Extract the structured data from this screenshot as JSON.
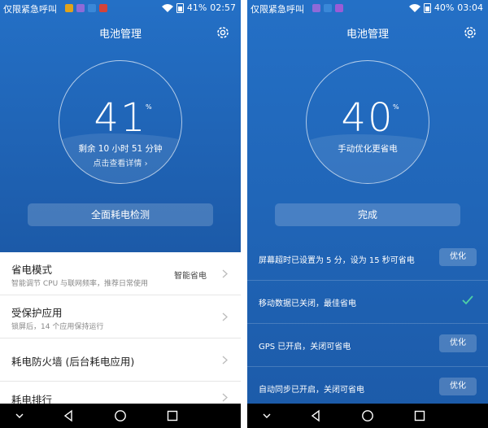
{
  "left": {
    "status": {
      "carrier": "仅限紧急呼叫",
      "battery": "41%",
      "time": "02:57"
    },
    "title": "电池管理",
    "ring": {
      "percent": "41",
      "percent_sign": "%",
      "remaining": "剩余 10 小时 51 分钟",
      "detail_link": "点击查看详情"
    },
    "main_button": "全面耗电检测",
    "items": [
      {
        "title": "省电模式",
        "subtitle": "智能调节 CPU 与联网频率，推荐日常使用",
        "value": "智能省电"
      },
      {
        "title": "受保护应用",
        "subtitle": "锁屏后，14 个应用保持运行"
      },
      {
        "title": "耗电防火墙 (后台耗电应用)"
      },
      {
        "title": "耗电排行"
      }
    ]
  },
  "right": {
    "status": {
      "carrier": "仅限紧急呼叫",
      "battery": "40%",
      "time": "03:04"
    },
    "title": "电池管理",
    "ring": {
      "percent": "40",
      "percent_sign": "%",
      "status_text": "手动优化更省电"
    },
    "main_button": "完成",
    "items": [
      {
        "text": "屏幕超时已设置为 5 分，设为 15 秒可省电",
        "action": "优化"
      },
      {
        "text": "移动数据已关闭，最佳省电"
      },
      {
        "text": "GPS 已开启，关闭可省电",
        "action": "优化"
      },
      {
        "text": "自动同步已开启，关闭可省电",
        "action": "优化"
      }
    ]
  },
  "colors": {
    "primary_blue": "#2470c6",
    "check_green": "#4fd1a5"
  },
  "icons": [
    "wifi-icon",
    "battery-icon",
    "gear-icon",
    "chevron-right-icon",
    "back-icon",
    "home-icon",
    "recents-icon",
    "nav-dropdown-icon",
    "check-icon"
  ]
}
